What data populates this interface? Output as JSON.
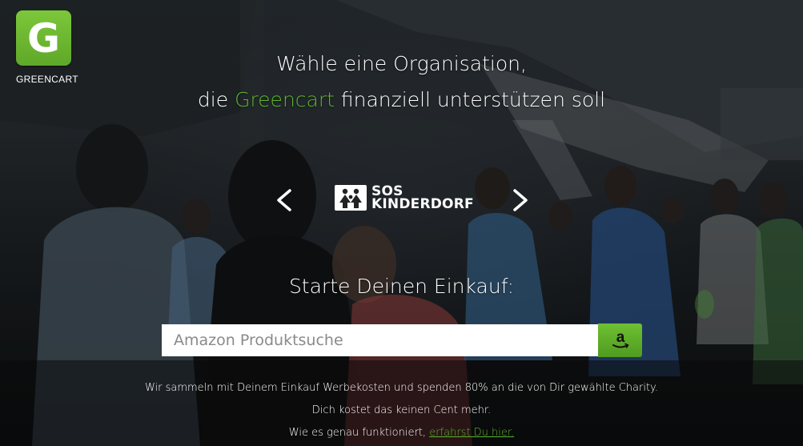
{
  "brand": {
    "logo_letter": "G",
    "name": "GREENCART",
    "accent_color": "#5cb52e"
  },
  "headline": {
    "line1": "Wähle eine Organisation,",
    "line2_prefix": "die",
    "line2_brand": "Greencart",
    "line2_suffix": "finanziell unterstützen soll"
  },
  "carousel": {
    "prev_icon": "chevron-left-icon",
    "next_icon": "chevron-right-icon",
    "organization": {
      "name_line1": "SOS",
      "name_line2": "KINDERDORF"
    }
  },
  "start": {
    "label": "Starte Deinen Einkauf:"
  },
  "search": {
    "placeholder": "Amazon Produktsuche",
    "value": "",
    "button_icon": "amazon-icon",
    "button_glyph": "a"
  },
  "info": {
    "line1": "Wir sammeln mit Deinem Einkauf Werbekosten und spenden 80% an die von Dir gewählte Charity.",
    "line2": "Dich kostet das keinen Cent mehr.",
    "line3_prefix": "Wie es genau funktioniert,",
    "line3_link": "erfahrst Du hier."
  }
}
